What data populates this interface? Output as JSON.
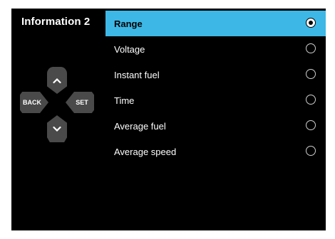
{
  "screen": {
    "title": "Information 2"
  },
  "menu": {
    "items": [
      {
        "label": "Range",
        "selected": true
      },
      {
        "label": "Voltage",
        "selected": false
      },
      {
        "label": "Instant fuel",
        "selected": false
      },
      {
        "label": "Time",
        "selected": false
      },
      {
        "label": "Average fuel",
        "selected": false
      },
      {
        "label": "Average speed",
        "selected": false
      }
    ]
  },
  "controls": {
    "back_label": "BACK",
    "set_label": "SET",
    "up_icon": "chevron-up-icon",
    "down_icon": "chevron-down-icon"
  },
  "colors": {
    "background": "#000000",
    "highlight": "#3db8e6",
    "button": "#4a4a4a",
    "text": "#ffffff"
  }
}
